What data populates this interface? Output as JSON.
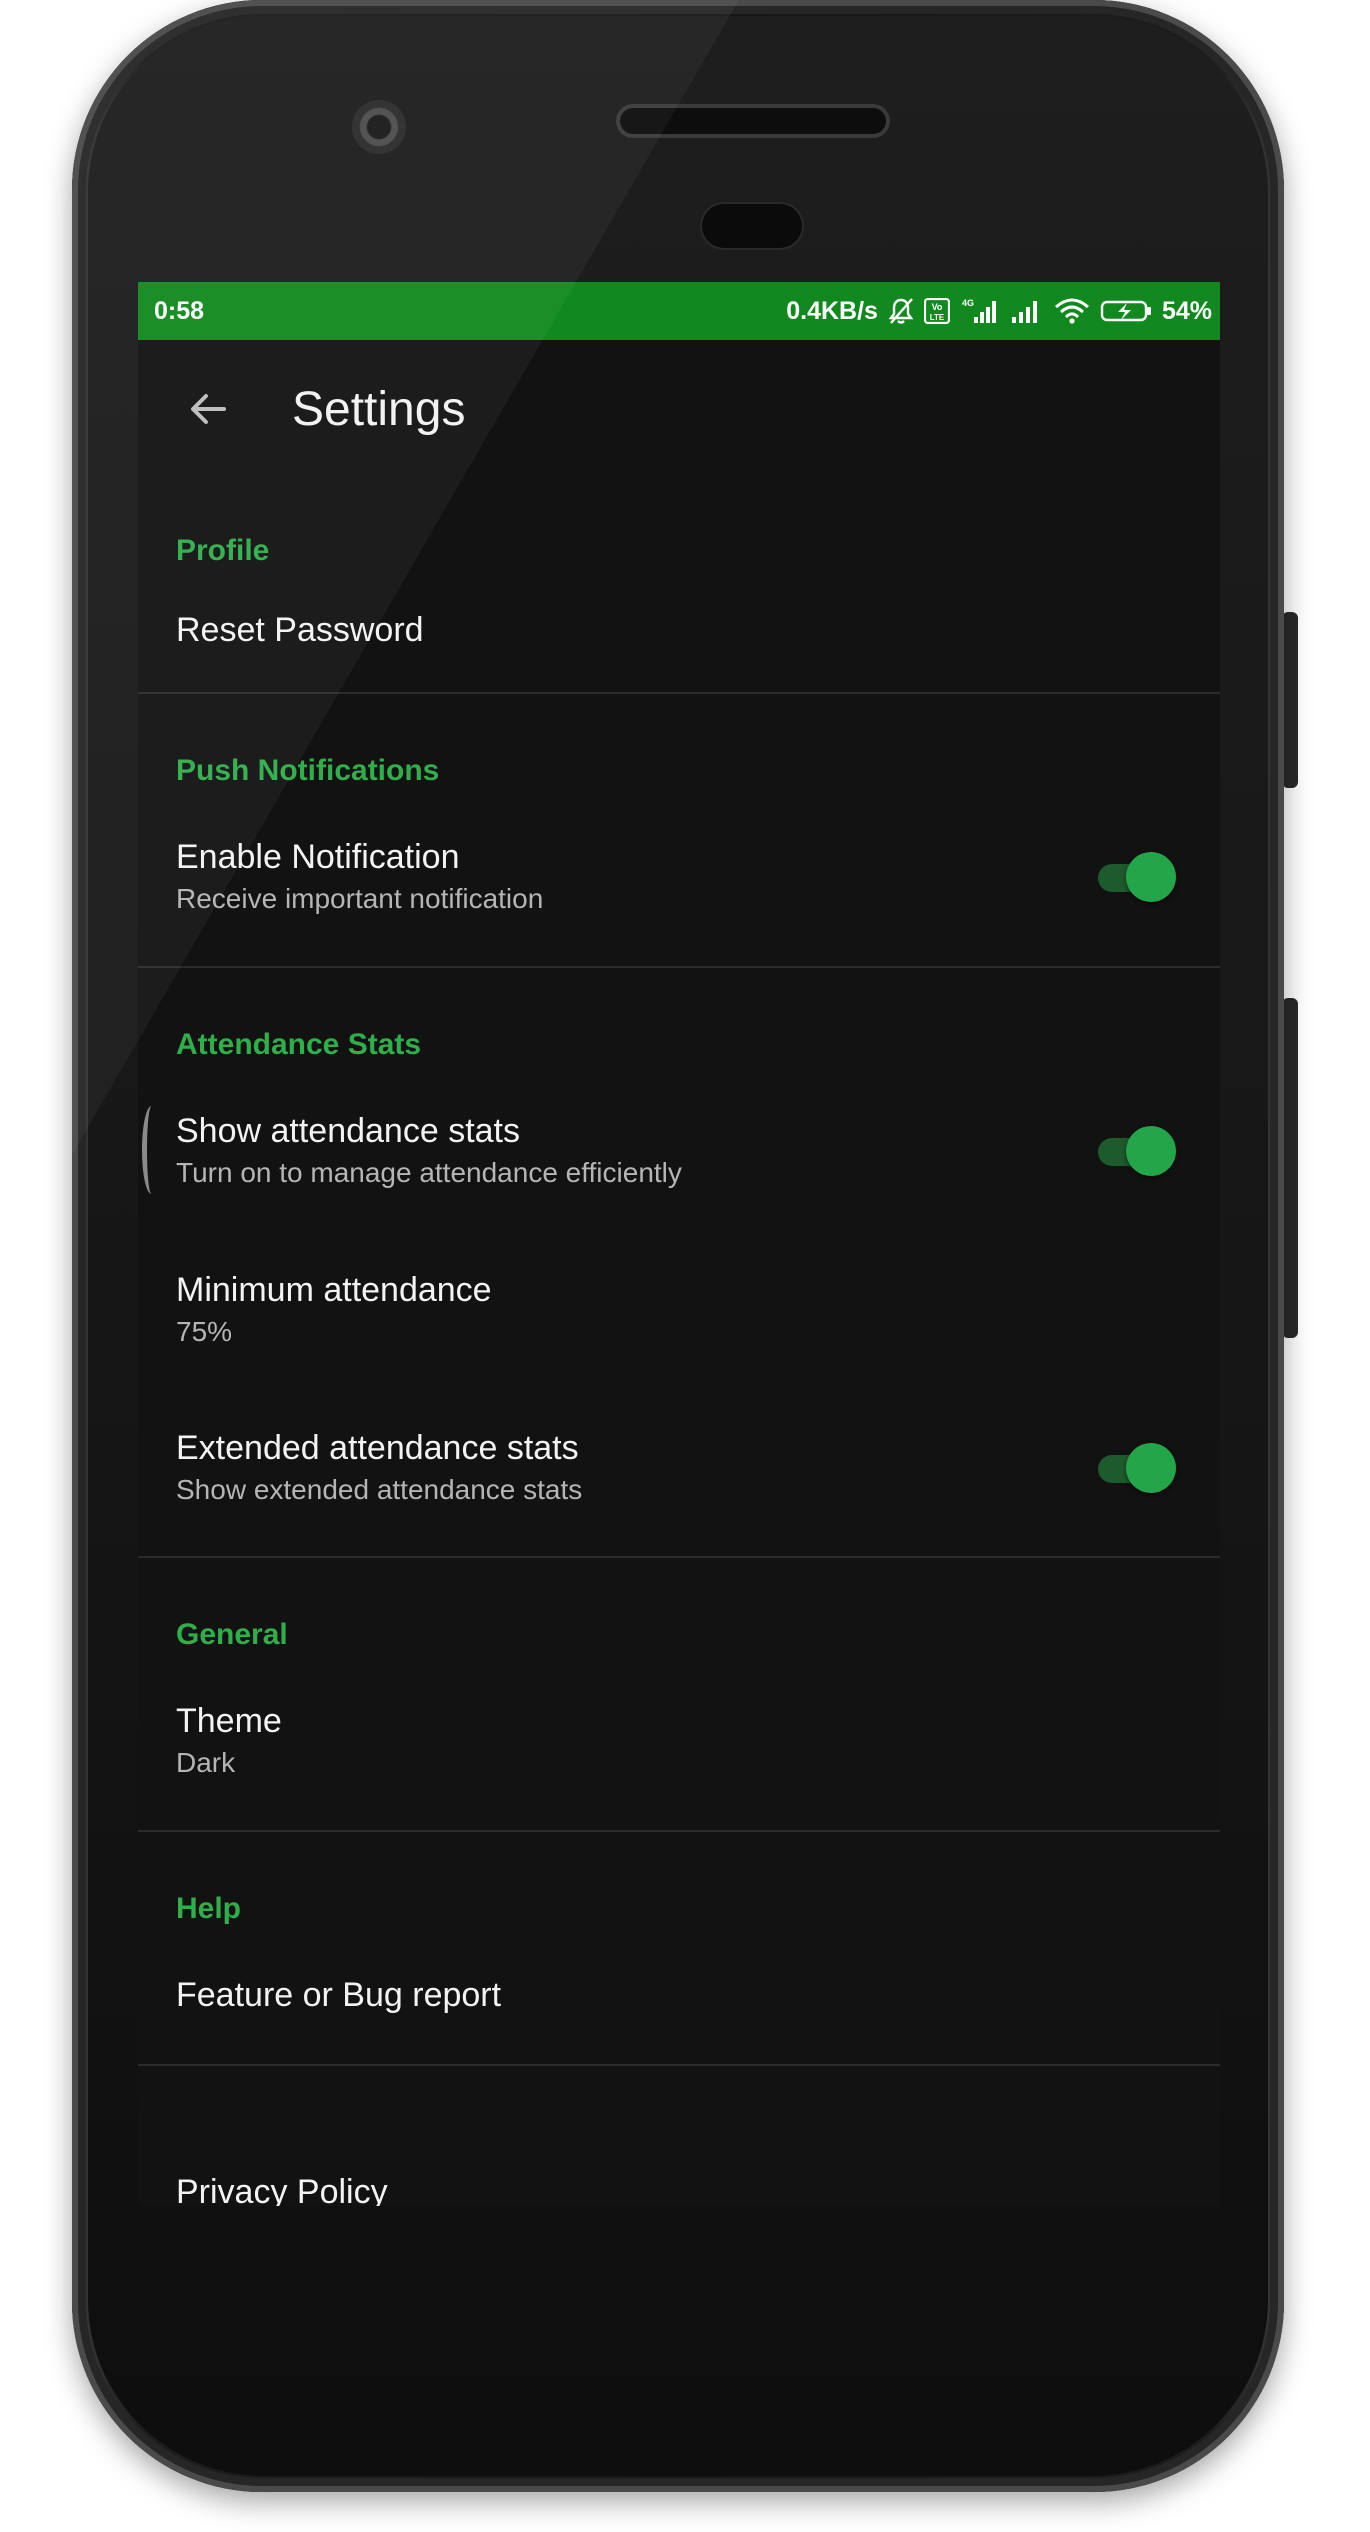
{
  "statusbar": {
    "time": "0:58",
    "net_speed": "0.4KB/s",
    "battery": "54%",
    "volte_label": "Vo LTE",
    "lte_label": "4G",
    "color": "#12891f"
  },
  "appbar": {
    "title": "Settings"
  },
  "accent_color": "#2fae4a",
  "sections": {
    "profile": {
      "header": "Profile",
      "reset_password": {
        "title": "Reset Password"
      }
    },
    "push": {
      "header": "Push Notifications",
      "enable_notification": {
        "title": "Enable Notification",
        "summary": "Receive important notification",
        "checked": true
      }
    },
    "attendance": {
      "header": "Attendance Stats",
      "show_stats": {
        "title": "Show attendance stats",
        "summary": "Turn on to manage attendance efficiently",
        "checked": true
      },
      "minimum": {
        "title": "Minimum attendance",
        "summary": "75%"
      },
      "extended": {
        "title": "Extended attendance stats",
        "summary": "Show extended attendance stats",
        "checked": true
      }
    },
    "general": {
      "header": "General",
      "theme": {
        "title": "Theme",
        "summary": "Dark"
      }
    },
    "help": {
      "header": "Help",
      "bug_report": {
        "title": "Feature or Bug report"
      }
    },
    "more": {
      "privacy_policy": {
        "title": "Privacy Policy"
      }
    }
  }
}
